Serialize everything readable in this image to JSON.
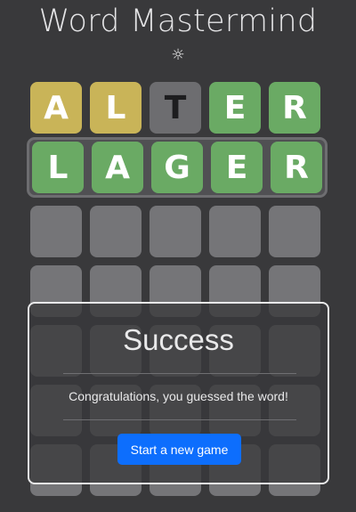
{
  "app": {
    "title": "Word Mastermind",
    "theme_icon": "sun-icon",
    "theme_glyph": "☼"
  },
  "board": {
    "rows": [
      {
        "state": "submitted",
        "tiles": [
          {
            "letter": "A",
            "status": "present"
          },
          {
            "letter": "L",
            "status": "present"
          },
          {
            "letter": "T",
            "status": "absent"
          },
          {
            "letter": "E",
            "status": "correct"
          },
          {
            "letter": "R",
            "status": "correct"
          }
        ]
      },
      {
        "state": "submitted-active",
        "tiles": [
          {
            "letter": "L",
            "status": "correct"
          },
          {
            "letter": "A",
            "status": "correct"
          },
          {
            "letter": "G",
            "status": "correct"
          },
          {
            "letter": "E",
            "status": "correct"
          },
          {
            "letter": "R",
            "status": "correct"
          }
        ]
      },
      {
        "state": "empty",
        "tiles": [
          {
            "letter": ""
          },
          {
            "letter": ""
          },
          {
            "letter": ""
          },
          {
            "letter": ""
          },
          {
            "letter": ""
          }
        ]
      },
      {
        "state": "empty",
        "tiles": [
          {
            "letter": ""
          },
          {
            "letter": ""
          },
          {
            "letter": ""
          },
          {
            "letter": ""
          },
          {
            "letter": ""
          }
        ]
      },
      {
        "state": "empty",
        "tiles": [
          {
            "letter": ""
          },
          {
            "letter": ""
          },
          {
            "letter": ""
          },
          {
            "letter": ""
          },
          {
            "letter": ""
          }
        ]
      },
      {
        "state": "empty",
        "tiles": [
          {
            "letter": ""
          },
          {
            "letter": ""
          },
          {
            "letter": ""
          },
          {
            "letter": ""
          },
          {
            "letter": ""
          }
        ]
      },
      {
        "state": "empty",
        "tiles": [
          {
            "letter": ""
          },
          {
            "letter": ""
          },
          {
            "letter": ""
          },
          {
            "letter": ""
          },
          {
            "letter": ""
          }
        ]
      }
    ]
  },
  "modal": {
    "title": "Success",
    "message": "Congratulations, you guessed the word!",
    "button_label": "Start a new game"
  },
  "colors": {
    "background": "#39393b",
    "present": "#c9b458",
    "absent": "#6d6d70",
    "correct": "#6aaa64",
    "empty": "#757578",
    "button": "#0d6efd"
  }
}
